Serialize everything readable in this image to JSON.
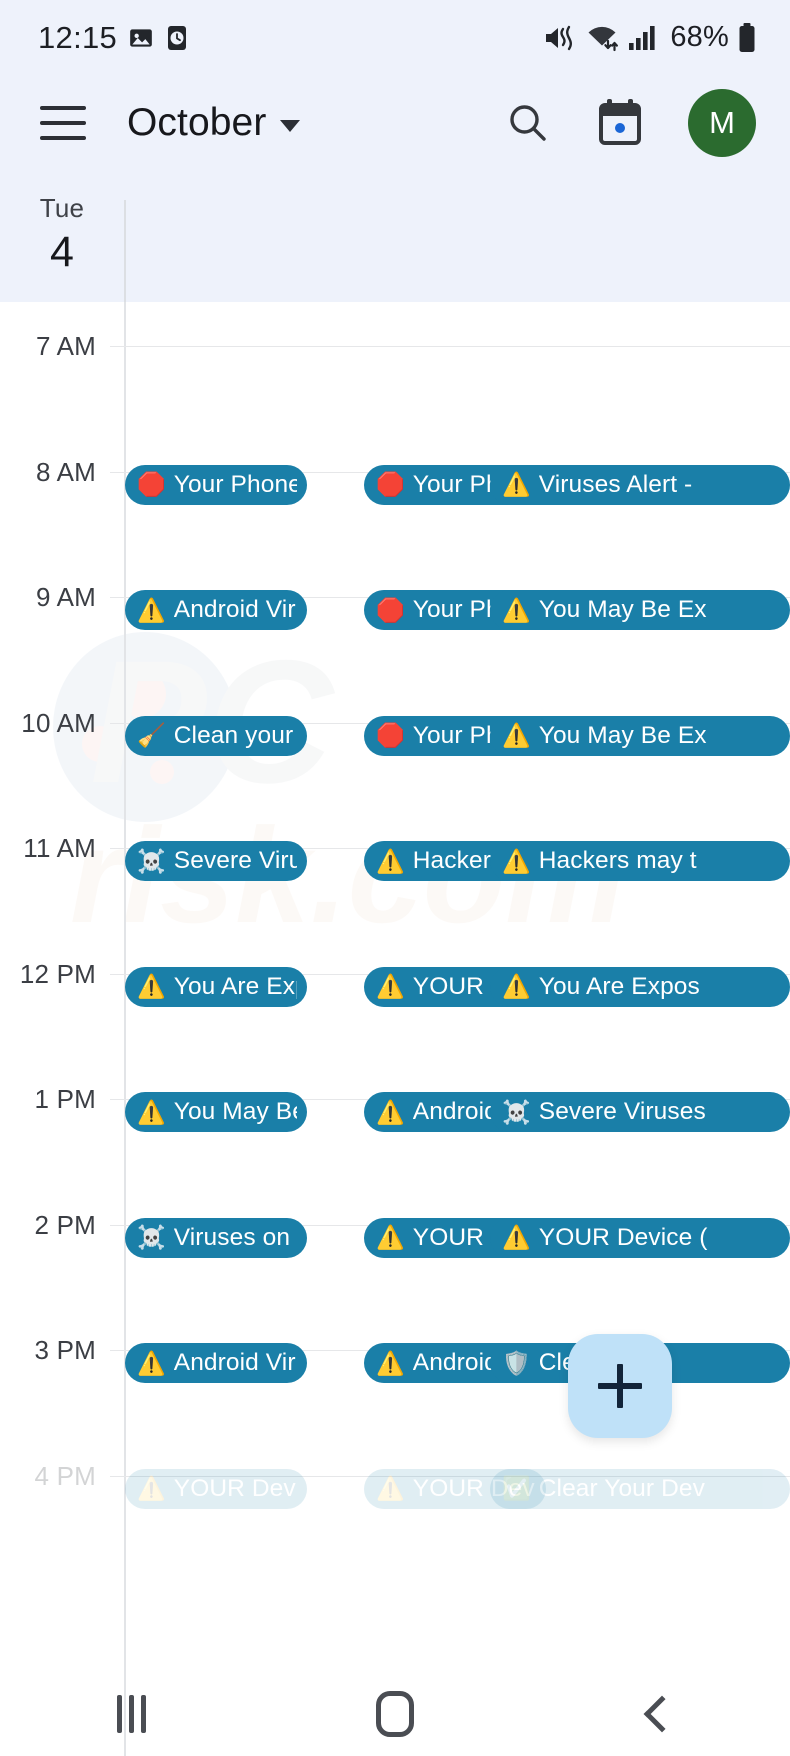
{
  "status_bar": {
    "time": "12:15",
    "battery_percent": "68%",
    "icons": [
      "image-icon",
      "clock-icon",
      "mute-vibrate-icon",
      "wifi-icon",
      "cellular-signal-icon",
      "battery-icon"
    ]
  },
  "app_bar": {
    "menu_icon": "hamburger-menu-icon",
    "title": "October",
    "dropdown_icon": "chevron-down-icon",
    "search_icon": "search-icon",
    "today_icon": "calendar-today-icon",
    "avatar_initial": "M"
  },
  "day_header": {
    "weekday": "Tue",
    "day_number": "4"
  },
  "hours": [
    "7 AM",
    "8 AM",
    "9 AM",
    "10 AM",
    "11 AM",
    "12 PM",
    "1 PM",
    "2 PM",
    "3 PM",
    "4 PM"
  ],
  "colors": {
    "event_bg": "#1a7fa8",
    "event_text": "#ffffff",
    "header_bg": "#eef2fb",
    "fab_bg": "#bfe1f8",
    "avatar_bg": "#2b6b2f"
  },
  "events": [
    {
      "hour": "8 AM",
      "col": 0,
      "emoji": "🛑",
      "emoji_name": "stop-sign-icon",
      "label": "Your Phone is"
    },
    {
      "hour": "8 AM",
      "col": 1,
      "emoji": "🛑",
      "emoji_name": "stop-sign-icon",
      "label": "Your Phone is"
    },
    {
      "hour": "8 AM",
      "col": 2,
      "emoji": "⚠️",
      "emoji_name": "warning-icon",
      "label": "Viruses Alert -"
    },
    {
      "hour": "9 AM",
      "col": 0,
      "emoji": "⚠️",
      "emoji_name": "warning-icon",
      "label": "Android Virus"
    },
    {
      "hour": "9 AM",
      "col": 1,
      "emoji": "🛑",
      "emoji_name": "stop-sign-icon",
      "label": "Your Phone is"
    },
    {
      "hour": "9 AM",
      "col": 2,
      "emoji": "⚠️",
      "emoji_name": "warning-icon",
      "label": "You May Be Ex"
    },
    {
      "hour": "10 AM",
      "col": 0,
      "emoji": "🧹",
      "emoji_name": "broom-icon",
      "label": "Clean your Ph"
    },
    {
      "hour": "10 AM",
      "col": 1,
      "emoji": "🛑",
      "emoji_name": "stop-sign-icon",
      "label": "Your Phone is"
    },
    {
      "hour": "10 AM",
      "col": 2,
      "emoji": "⚠️",
      "emoji_name": "warning-icon",
      "label": "You May Be Ex"
    },
    {
      "hour": "11 AM",
      "col": 0,
      "emoji": "☠️",
      "emoji_name": "skull-crossbones-icon",
      "label": "Severe Viruses"
    },
    {
      "hour": "11 AM",
      "col": 1,
      "emoji": "⚠️",
      "emoji_name": "warning-icon",
      "label": "Hackers may t"
    },
    {
      "hour": "11 AM",
      "col": 2,
      "emoji": "⚠️",
      "emoji_name": "warning-icon",
      "label": "Hackers may t"
    },
    {
      "hour": "12 PM",
      "col": 0,
      "emoji": "⚠️",
      "emoji_name": "warning-icon",
      "label": "You Are Expos"
    },
    {
      "hour": "12 PM",
      "col": 1,
      "emoji": "⚠️",
      "emoji_name": "warning-icon",
      "label": "YOUR Device ("
    },
    {
      "hour": "12 PM",
      "col": 2,
      "emoji": "⚠️",
      "emoji_name": "warning-icon",
      "label": "You Are Expos"
    },
    {
      "hour": "1 PM",
      "col": 0,
      "emoji": "⚠️",
      "emoji_name": "warning-icon",
      "label": "You May Be Ex"
    },
    {
      "hour": "1 PM",
      "col": 1,
      "emoji": "⚠️",
      "emoji_name": "warning-icon",
      "label": "Android Virus"
    },
    {
      "hour": "1 PM",
      "col": 2,
      "emoji": "☠️",
      "emoji_name": "skull-crossbones-icon",
      "label": "Severe Viruses"
    },
    {
      "hour": "2 PM",
      "col": 0,
      "emoji": "☠️",
      "emoji_name": "skull-crossbones-icon",
      "label": "Viruses on you"
    },
    {
      "hour": "2 PM",
      "col": 1,
      "emoji": "⚠️",
      "emoji_name": "warning-icon",
      "label": "YOUR Device ("
    },
    {
      "hour": "2 PM",
      "col": 2,
      "emoji": "⚠️",
      "emoji_name": "warning-icon",
      "label": "YOUR Device ("
    },
    {
      "hour": "3 PM",
      "col": 0,
      "emoji": "⚠️",
      "emoji_name": "warning-icon",
      "label": "Android Virus"
    },
    {
      "hour": "3 PM",
      "col": 1,
      "emoji": "⚠️",
      "emoji_name": "warning-icon",
      "label": "Android Virus"
    },
    {
      "hour": "3 PM",
      "col": 2,
      "emoji": "🛡️",
      "emoji_name": "shield-icon",
      "label": "Cle"
    },
    {
      "hour": "4 PM",
      "col": 0,
      "emoji": "⚠️",
      "emoji_name": "warning-icon",
      "label": "YOUR Device (",
      "faded": true
    },
    {
      "hour": "4 PM",
      "col": 1,
      "emoji": "⚠️",
      "emoji_name": "warning-icon",
      "label": "YOUR Device (",
      "faded": true
    },
    {
      "hour": "4 PM",
      "col": 2,
      "emoji": "✅",
      "emoji_name": "check-mark-icon",
      "label": "Clear Your Dev",
      "faded": true
    }
  ],
  "fab": {
    "label": "+",
    "name": "add-event-button"
  },
  "nav_bar": {
    "recent_label": "recent-apps",
    "home_label": "home",
    "back_label": "back"
  }
}
